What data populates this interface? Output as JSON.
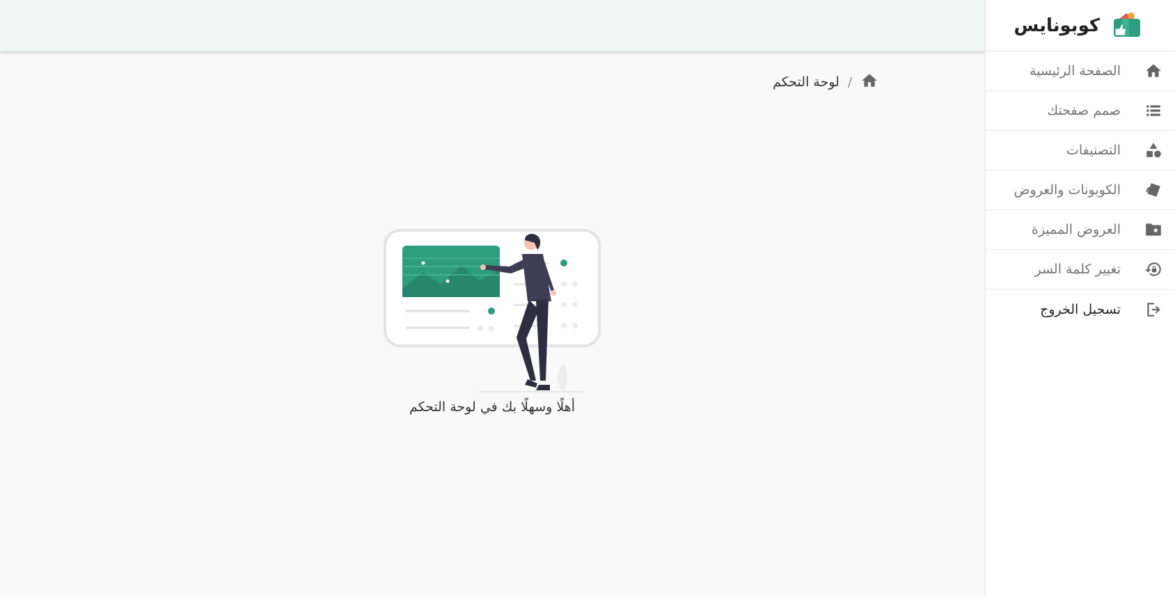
{
  "brand": {
    "name": "كوبونايس"
  },
  "sidebar": {
    "items": [
      {
        "label": "الصفحة الرئيسية",
        "icon": "home-icon"
      },
      {
        "label": "صمم صفحتك",
        "icon": "list-icon"
      },
      {
        "label": "التصنيفات",
        "icon": "category-icon"
      },
      {
        "label": "الكوبونات والعروض",
        "icon": "coupon-icon"
      },
      {
        "label": "العروض المميزة",
        "icon": "star-folder-icon"
      },
      {
        "label": "تغيير كلمة السر",
        "icon": "lock-reset-icon"
      },
      {
        "label": "تسجيل الخروج",
        "icon": "logout-icon"
      }
    ]
  },
  "breadcrumb": {
    "home_icon": "home-icon",
    "separator": "/",
    "current": "لوحة التحكم"
  },
  "main": {
    "welcome": "أهلًا وسهلًا بك في لوحة التحكم"
  },
  "colors": {
    "accent": "#2e9c7e",
    "topbar": "#eef6f3",
    "icon": "#666666"
  }
}
